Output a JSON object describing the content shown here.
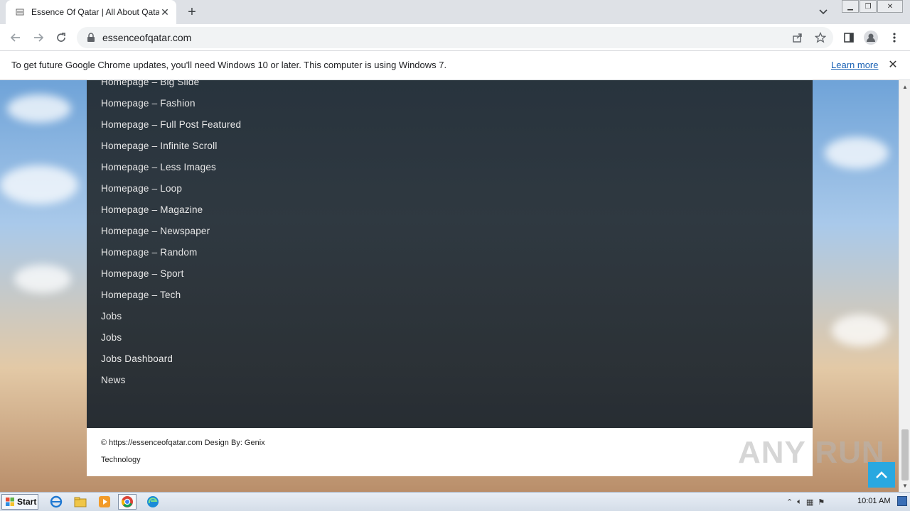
{
  "browser": {
    "tab_title": "Essence Of Qatar | All About Qatar",
    "url": "essenceofqatar.com"
  },
  "infobar": {
    "message": "To get future Google Chrome updates, you'll need Windows 10 or later. This computer is using Windows 7.",
    "learn_more": "Learn more"
  },
  "menu": {
    "items": [
      "Homepage – Big Slide",
      "Homepage – Fashion",
      "Homepage – Full Post Featured",
      "Homepage – Infinite Scroll",
      "Homepage – Less Images",
      "Homepage – Loop",
      "Homepage – Magazine",
      "Homepage – Newspaper",
      "Homepage – Random",
      "Homepage – Sport",
      "Homepage – Tech",
      "Jobs",
      "Jobs",
      "Jobs Dashboard",
      "News"
    ]
  },
  "footer": {
    "line1": "© https://essenceofqatar.com Design By: Genix",
    "line2": "Technology"
  },
  "watermark": "ANY RUN",
  "taskbar": {
    "start_label": "Start",
    "clock": "10:01 AM"
  }
}
